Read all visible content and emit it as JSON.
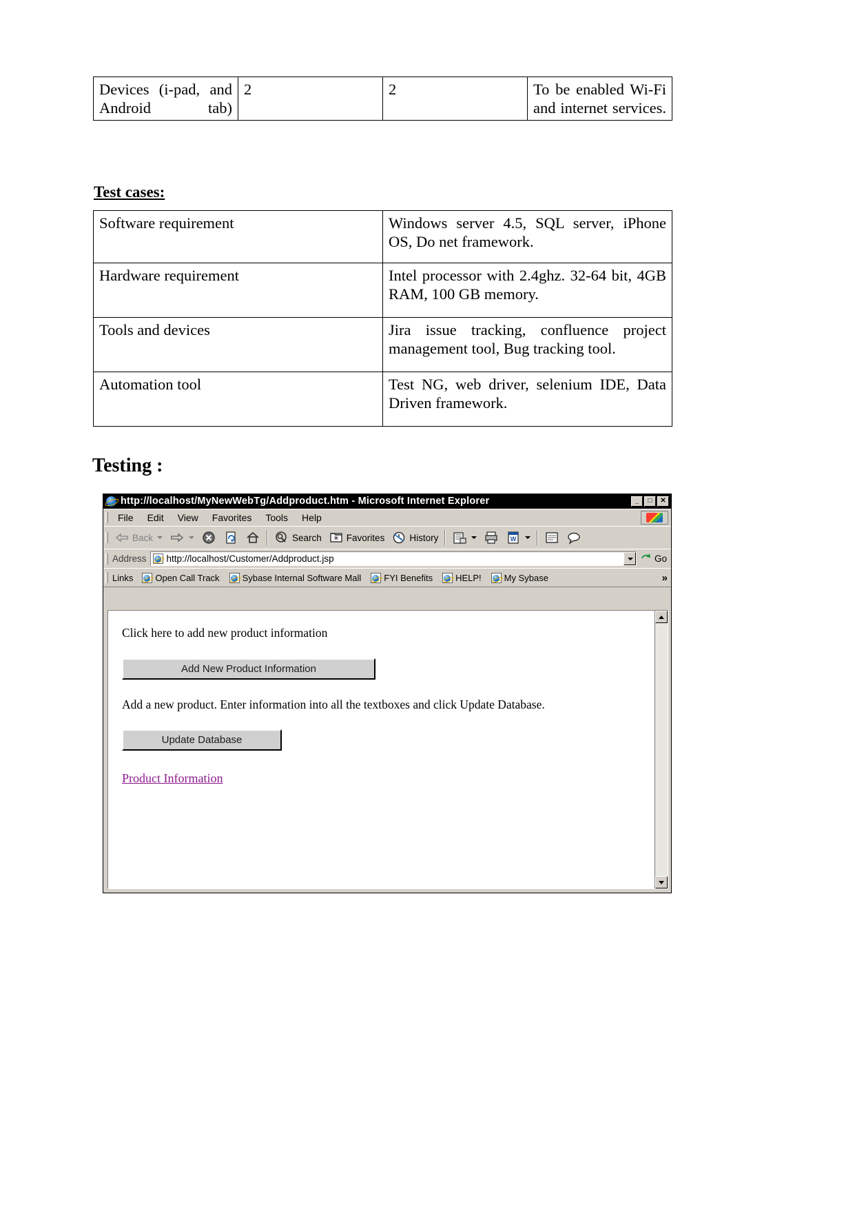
{
  "document": {
    "devices_table": {
      "rows": [
        {
          "cells": [
            "Devices (i-pad, and Android tab)",
            "2",
            "2",
            "To be enabled Wi-Fi and internet services."
          ]
        }
      ]
    },
    "test_cases_heading": "Test cases:",
    "test_cases_table": {
      "rows": [
        {
          "label": "Software requirement",
          "value": "Windows server 4.5, SQL server, iPhone OS, Do net framework."
        },
        {
          "label": "Hardware requirement",
          "value": "Intel processor with 2.4ghz. 32-64 bit, 4GB RAM, 100 GB memory."
        },
        {
          "label": "Tools and devices",
          "value": "Jira issue tracking, confluence project management tool, Bug tracking tool."
        },
        {
          "label": "Automation tool",
          "value": "Test NG, web driver, selenium IDE, Data Driven framework."
        }
      ]
    },
    "testing_heading": "Testing :"
  },
  "browser": {
    "title": "http://localhost/MyNewWebTg/Addproduct.htm - Microsoft Internet Explorer",
    "title_icon": "ie-logo-icon",
    "window_buttons": [
      {
        "name": "minimize",
        "glyph": "_"
      },
      {
        "name": "maximize",
        "glyph": "□"
      },
      {
        "name": "close",
        "glyph": "✕"
      }
    ],
    "menu": [
      {
        "label": "File"
      },
      {
        "label": "Edit"
      },
      {
        "label": "View"
      },
      {
        "label": "Favorites"
      },
      {
        "label": "Tools"
      },
      {
        "label": "Help"
      }
    ],
    "toolbar": {
      "back_label": "Back",
      "forward_label": "",
      "buttons": [
        {
          "name": "back-button",
          "label": "Back",
          "icon": "arrow-left-icon",
          "disabled": true,
          "has_dropdown": true
        },
        {
          "name": "forward-button",
          "label": "",
          "icon": "arrow-right-icon",
          "disabled": true,
          "has_dropdown": true
        },
        {
          "name": "stop-button",
          "label": "",
          "icon": "stop-icon",
          "disabled": false,
          "has_dropdown": false
        },
        {
          "name": "refresh-button",
          "label": "",
          "icon": "refresh-icon",
          "disabled": false,
          "has_dropdown": false
        },
        {
          "name": "home-button",
          "label": "",
          "icon": "home-icon",
          "disabled": false,
          "has_dropdown": false
        },
        {
          "name": "search-button",
          "label": "Search",
          "icon": "search-icon",
          "disabled": false,
          "has_dropdown": false
        },
        {
          "name": "favorites-button",
          "label": "Favorites",
          "icon": "favorites-star-icon",
          "disabled": false,
          "has_dropdown": false
        },
        {
          "name": "history-button",
          "label": "History",
          "icon": "history-clock-icon",
          "disabled": false,
          "has_dropdown": false
        },
        {
          "name": "mail-button",
          "label": "",
          "icon": "mail-icon",
          "disabled": false,
          "has_dropdown": true
        },
        {
          "name": "print-button",
          "label": "",
          "icon": "printer-icon",
          "disabled": false,
          "has_dropdown": false
        },
        {
          "name": "edit-button",
          "label": "",
          "icon": "word-edit-icon",
          "disabled": false,
          "has_dropdown": true
        },
        {
          "name": "messenger-button",
          "label": "",
          "icon": "messenger-icon",
          "disabled": false,
          "has_dropdown": false
        },
        {
          "name": "discuss-button",
          "label": "",
          "icon": "discuss-icon",
          "disabled": false,
          "has_dropdown": false
        }
      ]
    },
    "address": {
      "label": "Address",
      "value": "http://localhost/Customer/Addproduct.jsp",
      "icon": "ie-page-icon",
      "go_label": "Go",
      "go_icon": "go-arrow-icon"
    },
    "links": {
      "label": "Links",
      "items": [
        {
          "label": "Open Call Track",
          "icon": "ie-page-icon"
        },
        {
          "label": "Sybase Internal Software Mall",
          "icon": "ie-page-icon"
        },
        {
          "label": "FYI Benefits",
          "icon": "ie-page-icon"
        },
        {
          "label": "HELP!",
          "icon": "ie-page-icon"
        },
        {
          "label": "My Sybase",
          "icon": "ie-page-icon"
        }
      ],
      "overflow_glyph": "»"
    },
    "page": {
      "intro_text": "Click here to add new product information",
      "add_button_label": "Add New Product Information",
      "description_text": "Add a new product. Enter information into all the textboxes and click Update Database.",
      "update_button_label": "Update Database",
      "product_link_label": "Product Information",
      "link_color": "#8b1a8b"
    },
    "scrollbar": {
      "up_glyph": "▲",
      "down_glyph": "▼"
    }
  }
}
